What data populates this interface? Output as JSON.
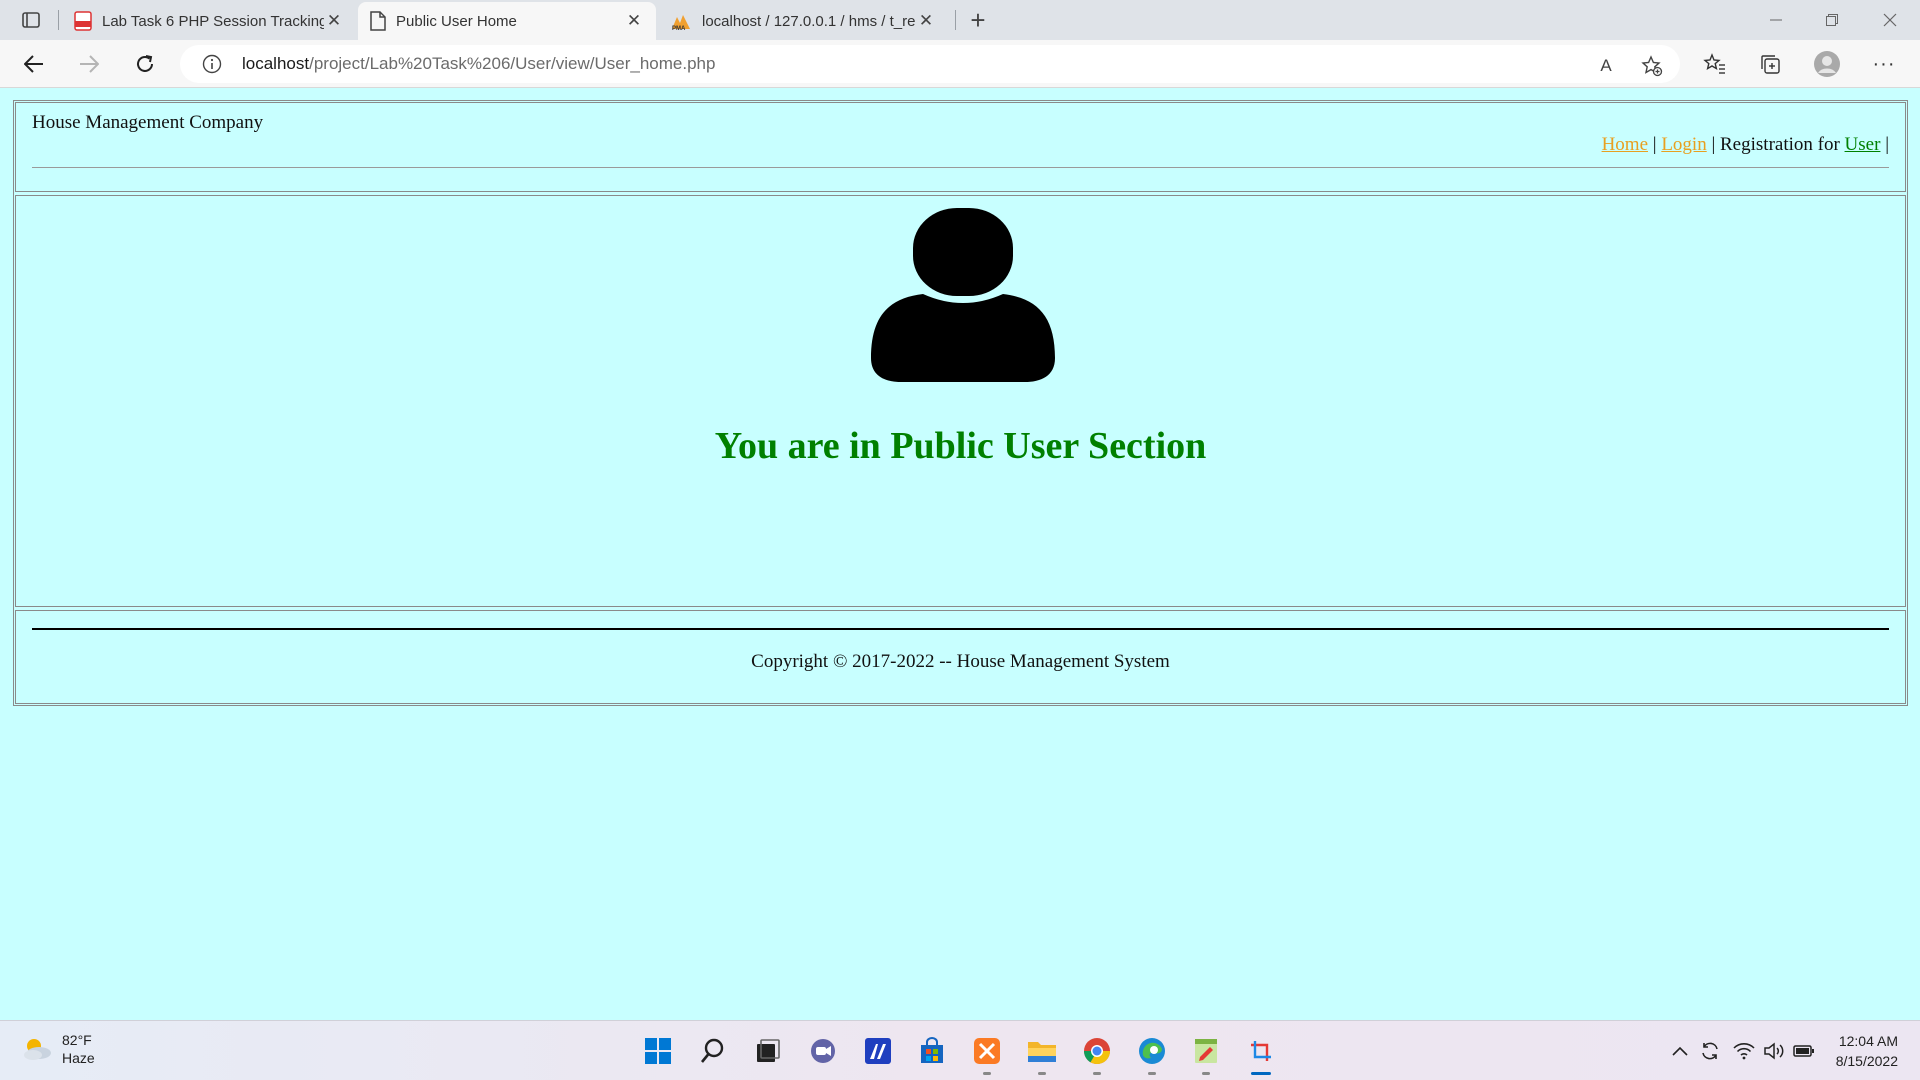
{
  "browser": {
    "tabs": [
      {
        "title": "Lab Task 6 PHP Session Tracking",
        "icon": "pdf-icon"
      },
      {
        "title": "Public User Home",
        "icon": "page-icon"
      },
      {
        "title": "localhost / 127.0.0.1 / hms / t_re",
        "icon": "phpmyadmin-icon"
      }
    ],
    "url_host": "localhost",
    "url_path": "/project/Lab%20Task%206/User/view/User_home.php"
  },
  "page": {
    "company": "House Management Company",
    "nav": {
      "home": "Home",
      "sep1": " | ",
      "login": "Login",
      "sep2": " | Registration for ",
      "user": "User",
      "sep3": " |"
    },
    "section_title": "You are in Public User Section",
    "copyright": "Copyright © 2017-2022 -- House Management System"
  },
  "taskbar": {
    "weather_temp": "82°F",
    "weather_desc": "Haze",
    "time": "12:04 AM",
    "date": "8/15/2022"
  },
  "colors": {
    "page_bg": "#c8ffff",
    "title_green": "#008000",
    "link_orange": "#e8a020"
  }
}
